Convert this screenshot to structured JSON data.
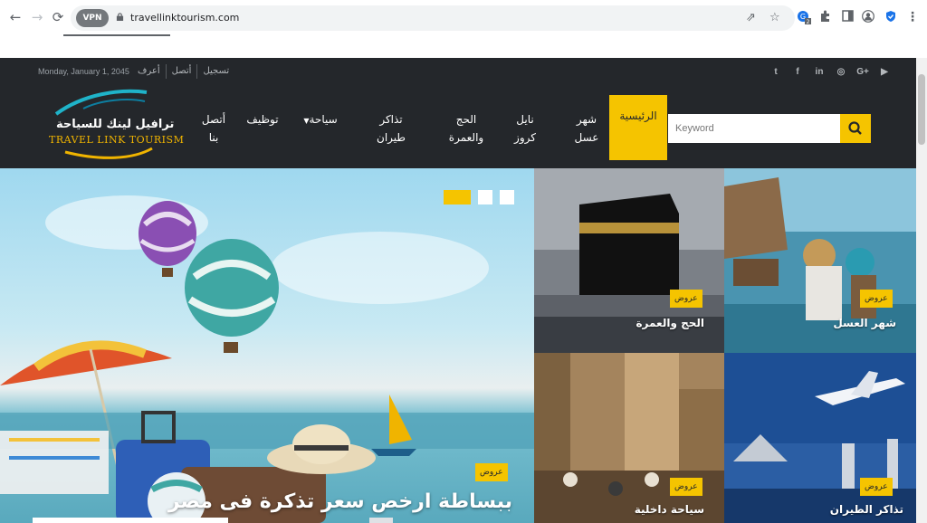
{
  "browser": {
    "url": "travellinktourism.com",
    "vpn_label": "VPN",
    "extension_badge": "2"
  },
  "site": {
    "date": "Monday, January 1, 2045",
    "top_links": [
      "تسجيل",
      "أتصل",
      "أعرف"
    ],
    "social_icons": [
      "youtube-icon",
      "google-plus-icon",
      "instagram-icon",
      "linkedin-icon",
      "facebook-icon",
      "twitter-icon"
    ],
    "logo": {
      "arabic": "ترافيل لينك للسياحة",
      "english": "TRAVEL LINK TOURISM"
    },
    "menu": {
      "home": "الرئيسية",
      "honeymoon": [
        "شهر",
        "عسل"
      ],
      "nile_cruise": [
        "نايل",
        "كروز"
      ],
      "hajj": [
        "الحج",
        "والعمرة"
      ],
      "tickets": [
        "تذاكر",
        "طيران"
      ],
      "tourism": "سياحة",
      "jobs": "توظيف",
      "contact": [
        "أتصل",
        "بنا"
      ]
    },
    "search": {
      "placeholder": "Keyword"
    },
    "hero": {
      "badge": "عروض",
      "title": "ببساطة ارخص سعر تذكرة فى مصر",
      "slider_count": 3,
      "active_slide": 1
    },
    "tiles": [
      {
        "badge": "عروض",
        "title": "الحج والعمرة"
      },
      {
        "badge": "عروض",
        "title": "شهر العسل"
      },
      {
        "badge": "عروض",
        "title": "سياحة داخلية"
      },
      {
        "badge": "عروض",
        "title": "تذاكر الطيران"
      }
    ],
    "colors": {
      "accent": "#f5c400",
      "header_bg": "#24272b"
    }
  }
}
